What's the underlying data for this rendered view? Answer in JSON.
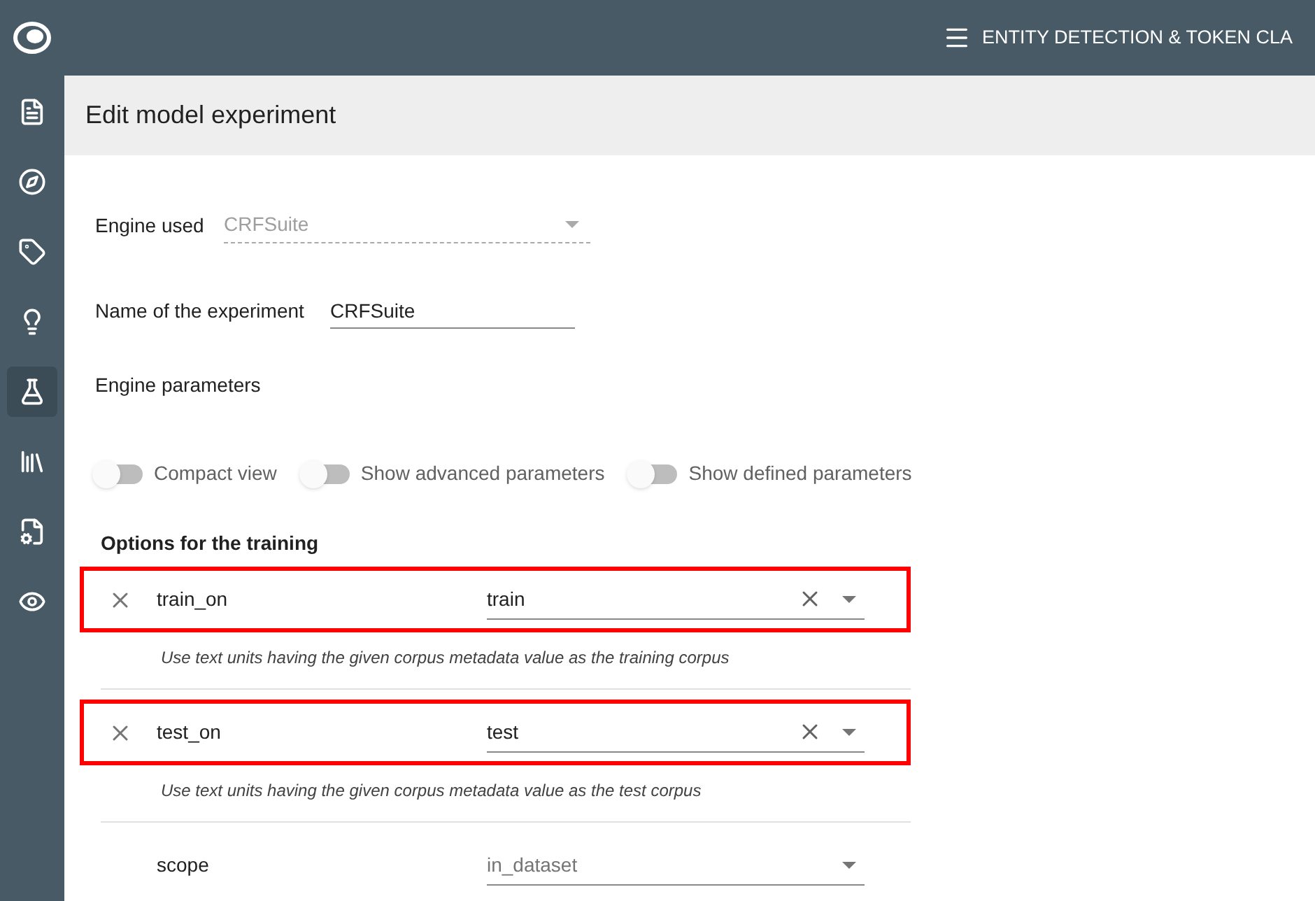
{
  "sidebar": {
    "items": [
      {
        "kind": "document",
        "selected": false
      },
      {
        "kind": "compass",
        "selected": false
      },
      {
        "kind": "tag",
        "selected": false
      },
      {
        "kind": "bulb",
        "selected": false
      },
      {
        "kind": "flask",
        "selected": true
      },
      {
        "kind": "library",
        "selected": false
      },
      {
        "kind": "file-gear",
        "selected": false
      },
      {
        "kind": "eye-check",
        "selected": false
      }
    ]
  },
  "top_bar": {
    "title": "ENTITY DETECTION & TOKEN CLA"
  },
  "page": {
    "title": "Edit model experiment"
  },
  "form": {
    "engine": {
      "label": "Engine used",
      "value": "CRFSuite",
      "disabled": true
    },
    "name": {
      "label": "Name of the experiment",
      "value": "CRFSuite"
    },
    "parameters_label": "Engine parameters"
  },
  "toggles": [
    {
      "label": "Compact view",
      "on": false
    },
    {
      "label": "Show advanced parameters",
      "on": false
    },
    {
      "label": "Show defined parameters",
      "on": false
    }
  ],
  "section_title": "Options for the training",
  "parameters": [
    {
      "name": "train_on",
      "value": "train",
      "removable": true,
      "clearable": true,
      "highlighted": true,
      "is_default": false,
      "description": "Use text units having the given corpus metadata value as the training corpus"
    },
    {
      "name": "test_on",
      "value": "test",
      "removable": true,
      "clearable": true,
      "highlighted": true,
      "is_default": false,
      "description": "Use text units having the given corpus metadata value as the test corpus"
    },
    {
      "name": "scope",
      "value": "in_dataset",
      "removable": false,
      "clearable": false,
      "highlighted": false,
      "is_default": true
    }
  ]
}
